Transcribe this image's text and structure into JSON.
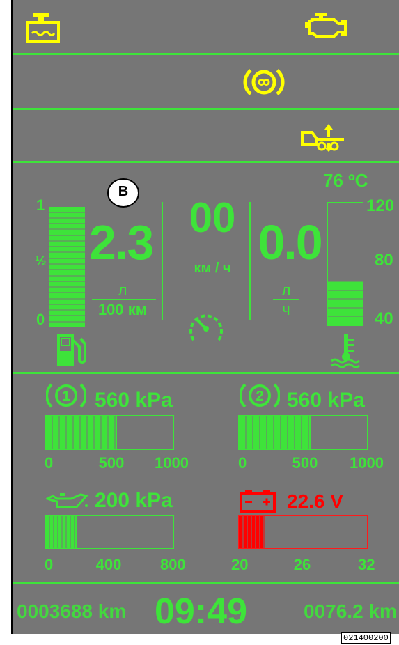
{
  "indicators": {
    "row1_left": "coolant-level-icon",
    "row1_right": "engine-check-icon",
    "row2": "parking-brake-icon",
    "row3": "trailer-lift-icon"
  },
  "callout_label": "B",
  "fuel": {
    "scale_top": "1",
    "scale_mid": "½",
    "scale_bottom": "0",
    "level": 0.95,
    "consumption_value": "2.3",
    "consumption_unit_top": "л",
    "consumption_unit_bottom": "100 км"
  },
  "speed": {
    "value": "00",
    "unit": "км / ч"
  },
  "hourly_consumption": {
    "value": "0.0",
    "unit_top": "л",
    "unit_bottom": "ч"
  },
  "coolant": {
    "temperature": "76 ºC",
    "scale_top": "120",
    "scale_mid": "80",
    "scale_bottom": "40",
    "level": 0.36
  },
  "brake_circuit_1": {
    "pressure": "560 kPa",
    "fill": 0.56,
    "scale": [
      "0",
      "500",
      "1000"
    ]
  },
  "brake_circuit_2": {
    "pressure": "560 kPa",
    "fill": 0.56,
    "scale": [
      "0",
      "500",
      "1000"
    ]
  },
  "oil": {
    "pressure": "200 kPa",
    "fill": 0.25,
    "scale": [
      "0",
      "400",
      "800"
    ]
  },
  "battery": {
    "voltage": "22.6 V",
    "fill": 0.2,
    "scale": [
      "20",
      "26",
      "32"
    ]
  },
  "footer": {
    "odometer": "0003688 km",
    "clock": "09:49",
    "trip": "0076.2 km"
  },
  "reference_code": "021400200",
  "colors": {
    "background": "#767676",
    "green": "#3ee33a",
    "yellow": "#ffff00",
    "red": "#ff0000"
  }
}
